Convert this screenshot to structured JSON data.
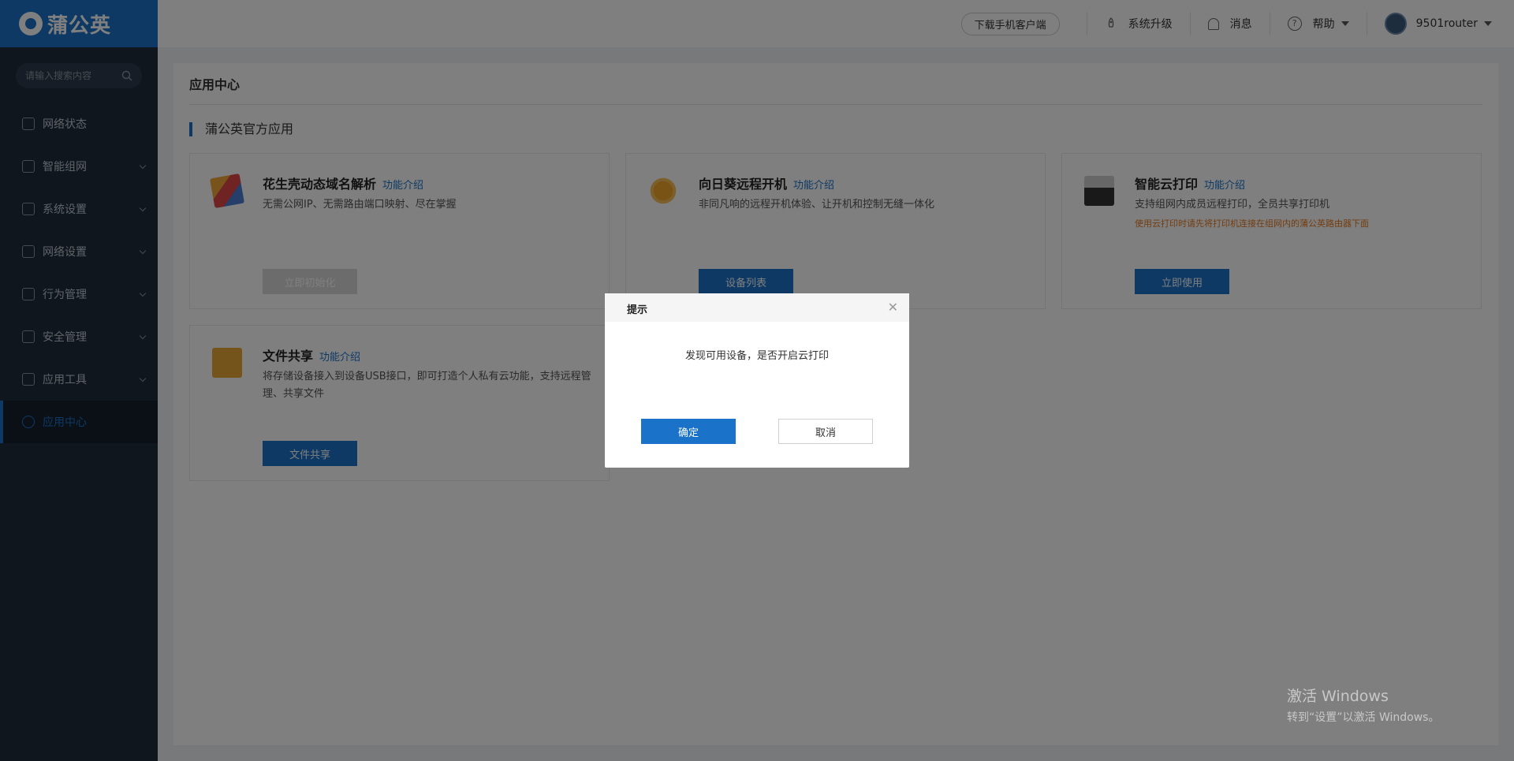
{
  "sidebar": {
    "logo_text": "蒲公英",
    "search_placeholder": "请输入搜索内容",
    "items": [
      {
        "label": "网络状态"
      },
      {
        "label": "智能组网"
      },
      {
        "label": "系统设置"
      },
      {
        "label": "网络设置"
      },
      {
        "label": "行为管理"
      },
      {
        "label": "安全管理"
      },
      {
        "label": "应用工具"
      },
      {
        "label": "应用中心"
      }
    ]
  },
  "header": {
    "download_label": "下载手机客户端",
    "upgrade_label": "系统升级",
    "message_label": "消息",
    "help_label": "帮助",
    "username": "9501router"
  },
  "main": {
    "page_title": "应用中心",
    "section_title": "蒲公英官方应用",
    "cards": [
      {
        "title": "花生壳动态域名解析",
        "link": "功能介绍",
        "desc": "无需公网IP、无需路由端口映射、尽在掌握",
        "button": "立即初始化",
        "icon": "cube-icon"
      },
      {
        "title": "向日葵远程开机",
        "link": "功能介绍",
        "desc": "非同凡响的远程开机体验、让开机和控制无缝一体化",
        "button": "设备列表",
        "icon": "sunflower-icon"
      },
      {
        "title": "智能云打印",
        "link": "功能介绍",
        "desc": "支持组网内成员远程打印，全员共享打印机",
        "note": "使用云打印时请先将打印机连接在组网内的蒲公英路由器下面",
        "button": "立即使用",
        "icon": "printer-icon"
      },
      {
        "title": "文件共享",
        "link": "功能介绍",
        "desc": "将存储设备接入到设备USB接口，即可打造个人私有云功能，支持远程管理、共享文件",
        "button": "文件共享",
        "icon": "folder-icon"
      }
    ]
  },
  "modal": {
    "title": "提示",
    "message": "发现可用设备，是否开启云打印",
    "ok_label": "确定",
    "cancel_label": "取消"
  },
  "watermark": {
    "line1": "激活 Windows",
    "line2": "转到“设置”以激活 Windows。"
  },
  "colors": {
    "accent": "#1a73c9",
    "sidebar_bg": "#1f2d3d",
    "warning_text": "#e6781e"
  }
}
